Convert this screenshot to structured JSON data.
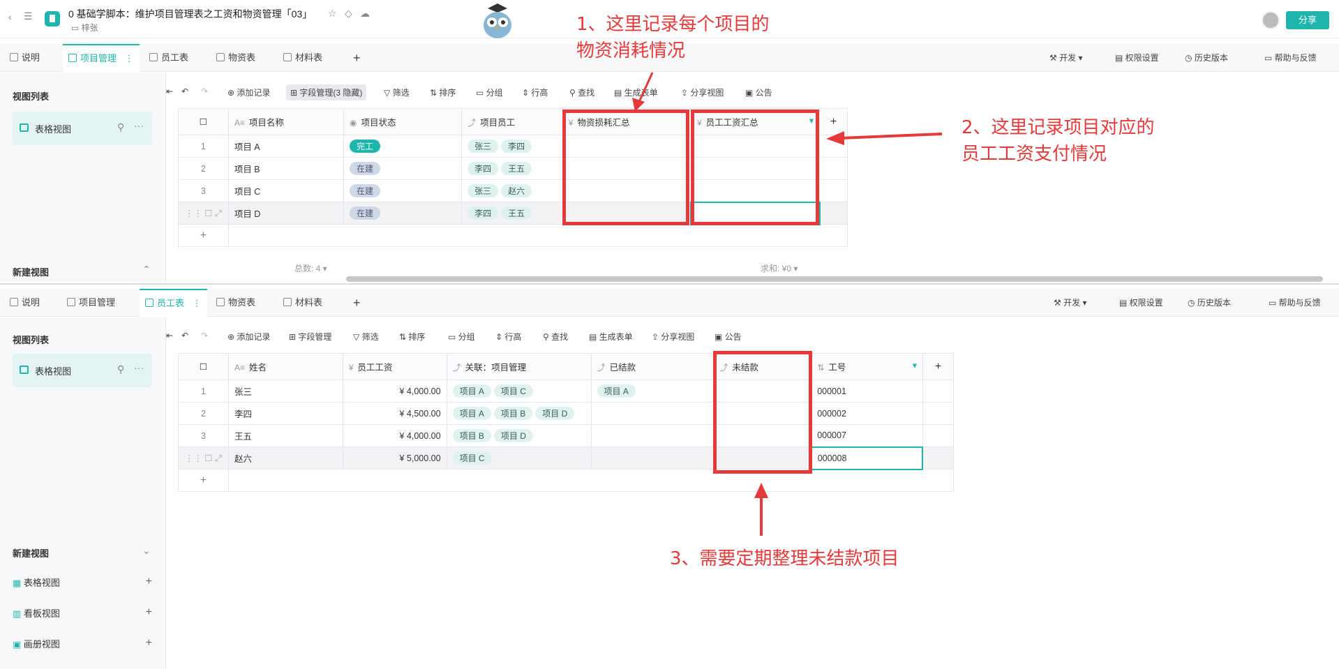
{
  "doc": {
    "title": "0 基础学脚本：维护项目管理表之工资和物资管理「03」",
    "owner": "梓张",
    "share_label": "分享"
  },
  "tabs_top": [
    "说明",
    "项目管理",
    "员工表",
    "物资表",
    "材料表"
  ],
  "tabs_bottom": [
    "说明",
    "项目管理",
    "员工表",
    "物资表",
    "材料表"
  ],
  "right_tabs": [
    "开发",
    "权限设置",
    "历史版本",
    "帮助与反馈"
  ],
  "sidebar": {
    "title": "视图列表",
    "view_name": "表格视图",
    "new_view": "新建视图",
    "new_view_items": [
      "表格视图",
      "看板视图",
      "画册视图"
    ]
  },
  "toolbar_top": [
    "添加记录",
    "字段管理(3 隐藏)",
    "筛选",
    "排序",
    "分组",
    "行高",
    "查找",
    "生成表单",
    "分享视图",
    "公告"
  ],
  "toolbar_bottom": [
    "添加记录",
    "字段管理",
    "筛选",
    "排序",
    "分组",
    "行高",
    "查找",
    "生成表单",
    "分享视图",
    "公告"
  ],
  "table_top": {
    "headers": [
      "项目名称",
      "项目状态",
      "项目员工",
      "物资损耗汇总",
      "员工工资汇总"
    ],
    "rows": [
      {
        "num": "1",
        "name": "项目 A",
        "status": "完工",
        "staff": [
          "张三",
          "李四"
        ]
      },
      {
        "num": "2",
        "name": "项目 B",
        "status": "在建",
        "staff": [
          "李四",
          "王五"
        ]
      },
      {
        "num": "3",
        "name": "项目 C",
        "status": "在建",
        "staff": [
          "张三",
          "赵六"
        ]
      },
      {
        "num": "",
        "name": "项目 D",
        "status": "在建",
        "staff": [
          "李四",
          "王五"
        ]
      }
    ],
    "footer_count": "总数: 4",
    "footer_sum": "求和: ¥0"
  },
  "table_bottom": {
    "headers": [
      "姓名",
      "员工工资",
      "关联：项目管理",
      "已结款",
      "未结款",
      "工号"
    ],
    "rows": [
      {
        "num": "1",
        "name": "张三",
        "salary": "¥ 4,000.00",
        "projects": [
          "项目 A",
          "项目 C"
        ],
        "paid": [
          "项目 A"
        ],
        "id": "000001"
      },
      {
        "num": "2",
        "name": "李四",
        "salary": "¥ 4,500.00",
        "projects": [
          "项目 A",
          "项目 B",
          "项目 D"
        ],
        "paid": [],
        "id": "000002"
      },
      {
        "num": "3",
        "name": "王五",
        "salary": "¥ 4,000.00",
        "projects": [
          "项目 B",
          "项目 D"
        ],
        "paid": [],
        "id": "000007"
      },
      {
        "num": "",
        "name": "赵六",
        "salary": "¥ 5,000.00",
        "projects": [
          "项目 C"
        ],
        "paid": [],
        "id": "000008"
      }
    ]
  },
  "annotations": {
    "note1_line1": "1、这里记录每个项目的",
    "note1_line2": "物资消耗情况",
    "note2_line1": "2、这里记录项目对应的",
    "note2_line2": "员工工资支付情况",
    "note3": "3、需要定期整理未结款项目"
  },
  "colors": {
    "accent": "#1fb5ac",
    "annotation": "#e63a3a"
  }
}
